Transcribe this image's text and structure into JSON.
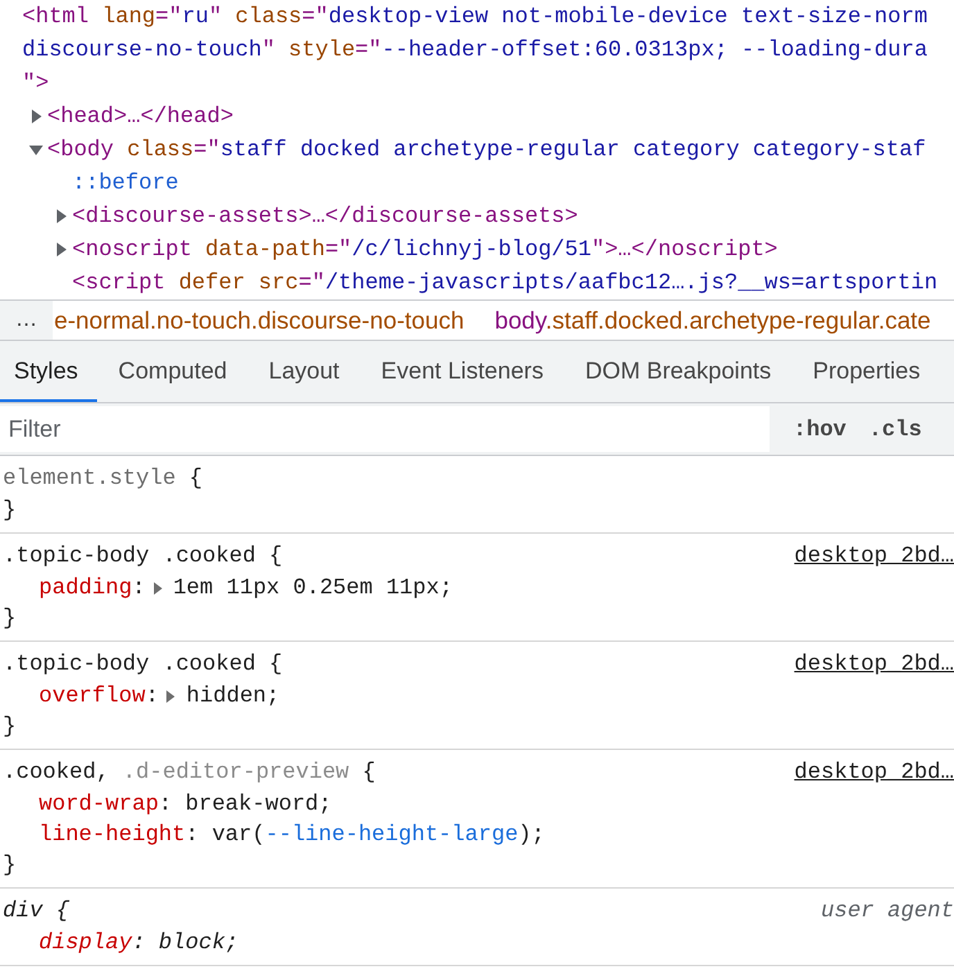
{
  "elements_tree": {
    "nodes": [
      {
        "lines": [
          [
            {
              "kind": "tag",
              "text": "<html"
            },
            {
              "kind": "attr",
              "text": " lang"
            },
            {
              "kind": "tag",
              "text": "=\""
            },
            {
              "kind": "value",
              "text": "ru"
            },
            {
              "kind": "tag",
              "text": "\""
            },
            {
              "kind": "attr",
              "text": " class"
            },
            {
              "kind": "tag",
              "text": "=\""
            },
            {
              "kind": "value",
              "text": "desktop-view not-mobile-device text-size-norm"
            }
          ],
          [
            {
              "kind": "value",
              "text": "discourse-no-touch"
            },
            {
              "kind": "tag",
              "text": "\""
            },
            {
              "kind": "attr",
              "text": " style"
            },
            {
              "kind": "tag",
              "text": "=\""
            },
            {
              "kind": "value",
              "text": "--header-offset:60.0313px; --loading-dura"
            }
          ],
          [
            {
              "kind": "tag",
              "text": "\">"
            }
          ]
        ],
        "children": [
          {
            "expanded": false,
            "lines": [
              [
                {
                  "kind": "tag",
                  "text": "<head>…</head>"
                }
              ]
            ]
          },
          {
            "expanded": true,
            "lines": [
              [
                {
                  "kind": "tag",
                  "text": "<body"
                },
                {
                  "kind": "attr",
                  "text": " class"
                },
                {
                  "kind": "tag",
                  "text": "=\""
                },
                {
                  "kind": "value",
                  "text": "staff docked archetype-regular category category-staf"
                }
              ]
            ],
            "children": [
              {
                "lines": [
                  [
                    {
                      "kind": "pseudo",
                      "text": "::before"
                    }
                  ]
                ]
              },
              {
                "expanded": false,
                "lines": [
                  [
                    {
                      "kind": "tag",
                      "text": "<discourse-assets>…</discourse-assets>"
                    }
                  ]
                ]
              },
              {
                "expanded": false,
                "lines": [
                  [
                    {
                      "kind": "tag",
                      "text": "<noscript"
                    },
                    {
                      "kind": "attr",
                      "text": " data-path"
                    },
                    {
                      "kind": "tag",
                      "text": "=\""
                    },
                    {
                      "kind": "value",
                      "text": "/c/lichnyj-blog/51"
                    },
                    {
                      "kind": "tag",
                      "text": "\">…</noscript>"
                    }
                  ]
                ]
              },
              {
                "lines": [
                  [
                    {
                      "kind": "tag",
                      "text": "<script"
                    },
                    {
                      "kind": "attr",
                      "text": " defer src"
                    },
                    {
                      "kind": "tag",
                      "text": "=\""
                    },
                    {
                      "kind": "value",
                      "text": "/theme-javascripts/aafbc12….js?__ws=artsportin"
                    }
                  ]
                ]
              }
            ]
          }
        ]
      }
    ]
  },
  "breadcrumbs": {
    "overflow": "…",
    "crumbs": [
      {
        "classes": "e-normal.no-touch.discourse-no-touch"
      },
      {
        "tag": "body",
        "classes": ".staff.docked.archetype-regular.cate"
      }
    ]
  },
  "styles_pane": {
    "tabs": [
      {
        "label": "Styles",
        "selected": true
      },
      {
        "label": "Computed",
        "selected": false
      },
      {
        "label": "Layout",
        "selected": false
      },
      {
        "label": "Event Listeners",
        "selected": false
      },
      {
        "label": "DOM Breakpoints",
        "selected": false
      },
      {
        "label": "Properties",
        "selected": false
      }
    ],
    "filter": {
      "placeholder": "Filter"
    },
    "toggles": [
      ":hov",
      ".cls"
    ],
    "rules": [
      {
        "kind": "inline",
        "selector": [
          {
            "kind": "inline",
            "text": "element.style"
          }
        ],
        "open": "{",
        "close": "}"
      },
      {
        "kind": "author",
        "selector": [
          {
            "kind": "matched",
            "text": ".topic-body .cooked"
          }
        ],
        "open": "{",
        "source": "desktop_2bd…",
        "declarations": [
          {
            "property": [
              {
                "kind": "name",
                "text": "padding"
              },
              {
                "kind": "punct",
                "text": ":"
              }
            ],
            "expanded": false,
            "value": [
              {
                "kind": "plain",
                "text": "1em 11px 0.25em 11px;"
              }
            ]
          }
        ],
        "close": "}"
      },
      {
        "kind": "author",
        "selector": [
          {
            "kind": "matched",
            "text": ".topic-body .cooked"
          }
        ],
        "open": "{",
        "source": "desktop_2bd…",
        "declarations": [
          {
            "property": [
              {
                "kind": "name",
                "text": "overflow"
              },
              {
                "kind": "punct",
                "text": ":"
              }
            ],
            "expanded": false,
            "value": [
              {
                "kind": "plain",
                "text": "hidden;"
              }
            ]
          }
        ],
        "close": "}"
      },
      {
        "kind": "author",
        "selector": [
          {
            "kind": "matched",
            "text": ".cooked,"
          },
          {
            "kind": "unmatched",
            "text": ".d-editor-preview"
          }
        ],
        "open": "{",
        "source": "desktop_2bd…",
        "declarations": [
          {
            "property": [
              {
                "kind": "name",
                "text": "word-wrap"
              },
              {
                "kind": "punct",
                "text": ":"
              }
            ],
            "value": [
              {
                "kind": "plain",
                "text": "break-word;"
              }
            ]
          },
          {
            "property": [
              {
                "kind": "name",
                "text": "line-height"
              },
              {
                "kind": "punct",
                "text": ":"
              }
            ],
            "value": [
              {
                "kind": "plain",
                "text": "var("
              },
              {
                "kind": "variable",
                "text": "--line-height-large"
              },
              {
                "kind": "plain",
                "text": ");"
              }
            ]
          }
        ],
        "close": "}"
      },
      {
        "kind": "agent",
        "selector": [
          {
            "kind": "matched",
            "text": "div"
          }
        ],
        "open": "{",
        "source": "user agent",
        "declarations": [
          {
            "property": [
              {
                "kind": "name",
                "text": "display"
              },
              {
                "kind": "punct",
                "text": ":"
              }
            ],
            "value": [
              {
                "kind": "plain",
                "text": "block;"
              }
            ]
          }
        ]
      }
    ]
  }
}
